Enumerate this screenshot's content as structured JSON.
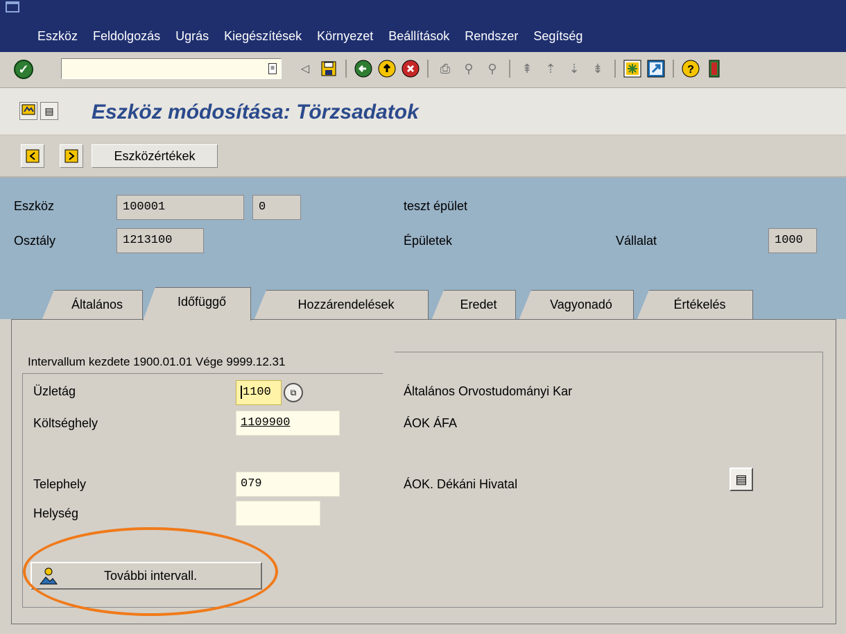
{
  "menu": {
    "items": [
      "Eszköz",
      "Feldolgozás",
      "Ugrás",
      "Kiegészítések",
      "Környezet",
      "Beállítások",
      "Rendszer",
      "Segítség"
    ]
  },
  "toolbar": {
    "command_value": "",
    "icons": [
      "ok-icon",
      "back-icon",
      "save-icon",
      "back-nav-icon",
      "exit-icon",
      "cancel-icon",
      "print-icon",
      "find-icon",
      "find-next-icon",
      "first-page-icon",
      "prev-page-icon",
      "next-page-icon",
      "last-page-icon",
      "new-session-icon",
      "shortcut-icon",
      "help-icon",
      "layout-icon"
    ]
  },
  "title": "Eszköz módosítása: Törzsadatok",
  "app_toolbar": {
    "button_label": "Eszközértékek"
  },
  "header": {
    "asset_label": "Eszköz",
    "asset_number": "100001",
    "asset_sub": "0",
    "asset_desc": "teszt épület",
    "class_label": "Osztály",
    "class_value": "1213100",
    "class_desc": "Épületek",
    "company_label": "Vállalat",
    "company_value": "1000"
  },
  "tabs": [
    "Általános",
    "Időfüggő",
    "Hozzárendelések",
    "Eredet",
    "Vagyonadó",
    "Értékelés"
  ],
  "active_tab": "Időfüggő",
  "interval": {
    "title": "Intervallum kezdete 1900.01.01 Vége 9999.12.31",
    "business_area_label": "Üzletág",
    "business_area_value": "1100",
    "business_area_desc": "Általános Orvostudományi Kar",
    "cost_center_label": "Költséghely",
    "cost_center_value": "1109900",
    "cost_center_desc": "ÁOK ÁFA",
    "plant_label": "Telephely",
    "plant_value": "079",
    "plant_desc": "ÁOK. Dékáni Hivatal",
    "location_label": "Helység",
    "location_value": "",
    "more_button_label": "További intervall."
  },
  "colors": {
    "menubar": "#1f2f6e",
    "header_bg": "#98b2c6",
    "title_text": "#2b4a8c",
    "highlight": "#f07a1a",
    "input_bg": "#fffde9"
  }
}
